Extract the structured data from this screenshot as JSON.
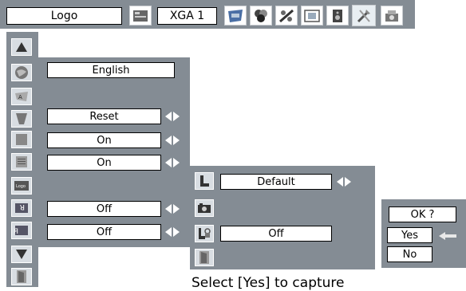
{
  "top_bar": {
    "logo_label": "Logo",
    "input_label": "XGA 1",
    "icons": [
      "picture-adjust-icon",
      "color-icon",
      "image-icon",
      "screen-icon",
      "sound-icon",
      "setting-icon",
      "info-icon"
    ]
  },
  "main_menu": {
    "sidebar_icons": [
      "up-arrow-icon",
      "globe-icon",
      "keystone-icon",
      "keystone-reset-icon",
      "blue-screen-icon",
      "display-icon",
      "logo-icon",
      "ceiling-icon",
      "rear-icon",
      "down-arrow-icon",
      "exit-icon"
    ],
    "language_value": "English",
    "keystone_value": "Reset",
    "blue_back_value": "On",
    "display_value": "On",
    "ceiling_value": "Off",
    "rear_value": "Off"
  },
  "logo_submenu": {
    "logo_select_value": "Default",
    "logo_pin_lock_value": "Off"
  },
  "confirm_dialog": {
    "question": "OK ?",
    "yes_label": "Yes",
    "no_label": "No"
  },
  "caption": "Select [Yes] to capture"
}
